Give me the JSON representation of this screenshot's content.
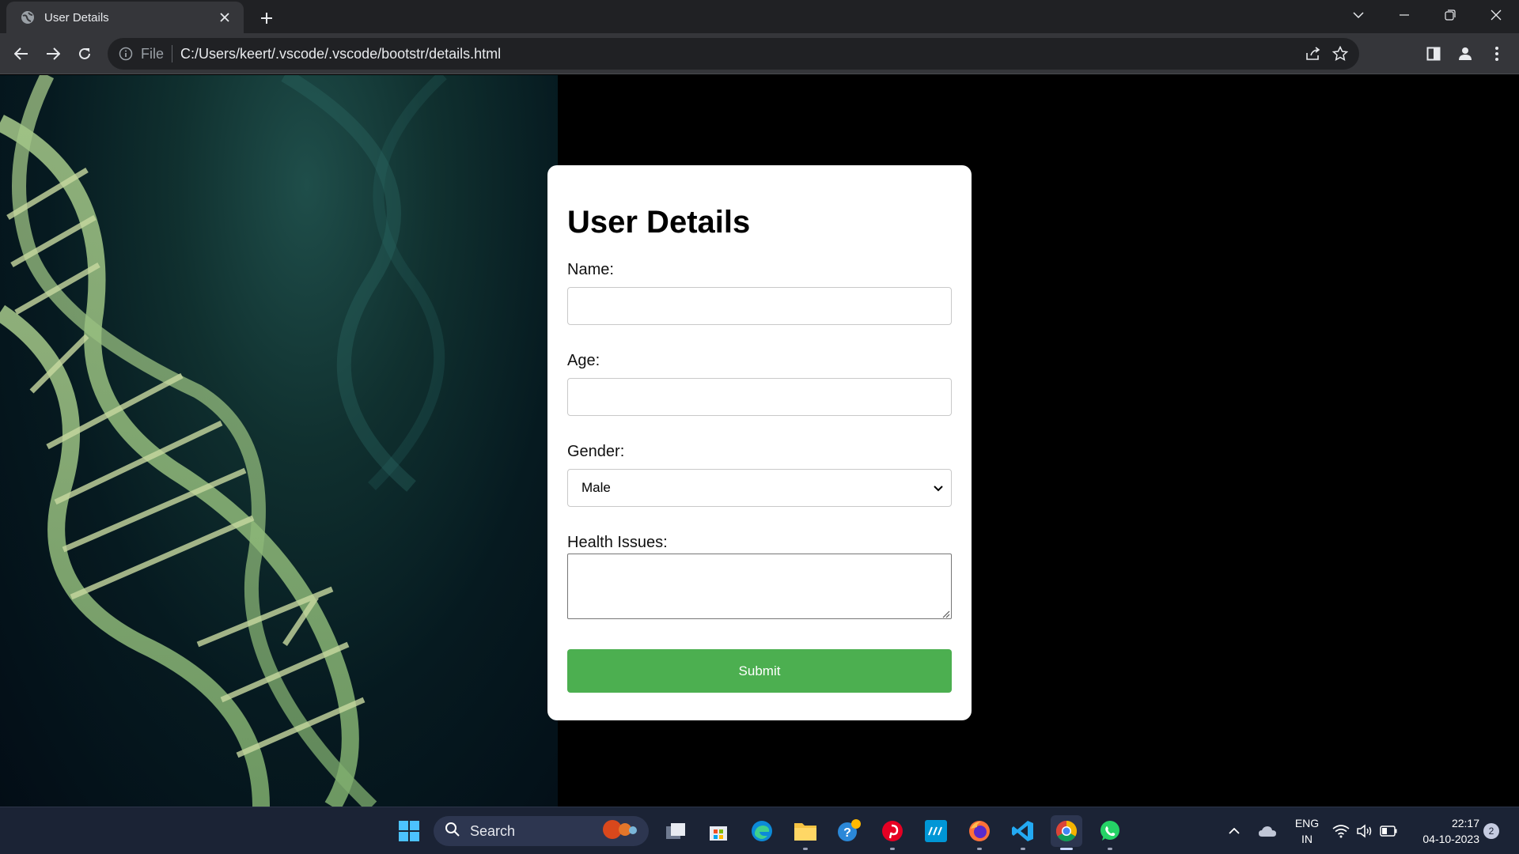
{
  "browser": {
    "tab_title": "User Details",
    "scheme_label": "File",
    "url": "C:/Users/keert/.vscode/.vscode/bootstr/details.html"
  },
  "form": {
    "heading": "User Details",
    "name_label": "Name:",
    "name_value": "",
    "age_label": "Age:",
    "age_value": "",
    "gender_label": "Gender:",
    "gender_value": "Male",
    "health_label": "Health Issues:",
    "health_value": "",
    "submit_label": "Submit",
    "submit_color": "#4caf50"
  },
  "taskbar": {
    "search_label": "Search",
    "language_line1": "ENG",
    "language_line2": "IN",
    "time": "22:17",
    "date": "04-10-2023",
    "notification_count": "2"
  }
}
